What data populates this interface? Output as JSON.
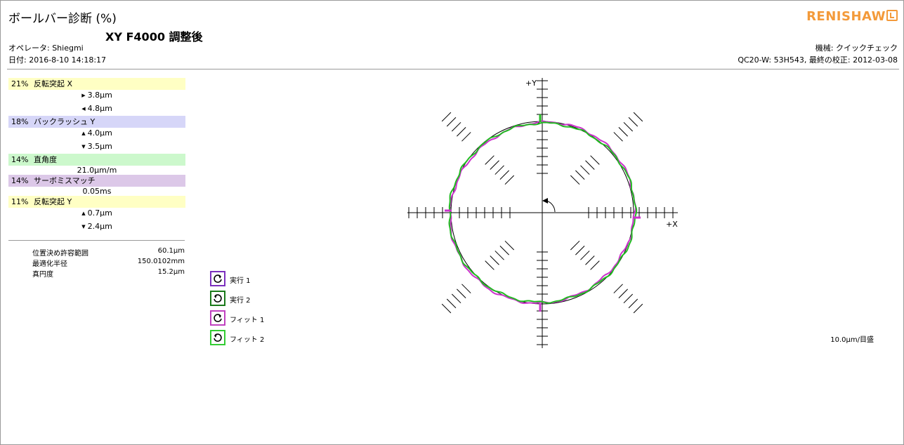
{
  "header": {
    "title": "ボールバー診断 (%)",
    "subtitle": "XY F4000 調整後",
    "operator": "オペレータ: Shiegmi",
    "date": "日付: 2016-8-10 14:18:17",
    "machine": "機械: クイックチェック",
    "calibration": "QC20-W: 53H543, 最終の校正: 2012-03-08",
    "logo": "RENISHAW"
  },
  "diagnostics": [
    {
      "percent": "21%",
      "label": "反転突起 X",
      "color": "#ffffc4",
      "values": [
        {
          "icon": "arrow-right-icon",
          "glyph": "▶",
          "text": "3.8μm"
        },
        {
          "icon": "arrow-left-icon",
          "glyph": "◀",
          "text": "4.8μm"
        }
      ]
    },
    {
      "percent": "18%",
      "label": "バックラッシュ Y",
      "color": "#d6d6f8",
      "values": [
        {
          "icon": "arrow-up-icon",
          "glyph": "▲",
          "text": "4.0μm"
        },
        {
          "icon": "arrow-down-icon",
          "glyph": "▼",
          "text": "3.5μm"
        }
      ]
    },
    {
      "percent": "14%",
      "label": "直角度",
      "color": "#ccf8cc",
      "values": [
        {
          "icon": "",
          "glyph": "",
          "text": "21.0μm/m"
        }
      ]
    },
    {
      "percent": "14%",
      "label": "サーボミスマッチ",
      "color": "#dcc8e8",
      "values": [
        {
          "icon": "",
          "glyph": "",
          "text": "0.05ms"
        }
      ]
    },
    {
      "percent": "11%",
      "label": "反転突起 Y",
      "color": "#ffffc4",
      "values": [
        {
          "icon": "arrow-up-icon",
          "glyph": "▲",
          "text": "0.7μm"
        },
        {
          "icon": "arrow-down-icon",
          "glyph": "▼",
          "text": "2.4μm"
        }
      ]
    }
  ],
  "stats": [
    {
      "label": "位置決め許容範囲",
      "value": "60.1μm"
    },
    {
      "label": "最適化半径",
      "value": "150.0102mm"
    },
    {
      "label": "真円度",
      "value": "15.2μm"
    }
  ],
  "legend": [
    {
      "label": "実行 1",
      "color": "#7b2fbe",
      "direction": "ccw"
    },
    {
      "label": "実行 2",
      "color": "#1a7a1a",
      "direction": "cw"
    },
    {
      "label": "フィット 1",
      "color": "#c040c0",
      "direction": "ccw"
    },
    {
      "label": "フィット 2",
      "color": "#33cc33",
      "direction": "cw"
    }
  ],
  "plot": {
    "x_axis_label": "+X",
    "y_axis_label": "+Y",
    "scale": "10.0μm/目盛",
    "colors": {
      "run1": "#cc33cc",
      "run2": "#22bb22",
      "reference": "#000000"
    }
  }
}
